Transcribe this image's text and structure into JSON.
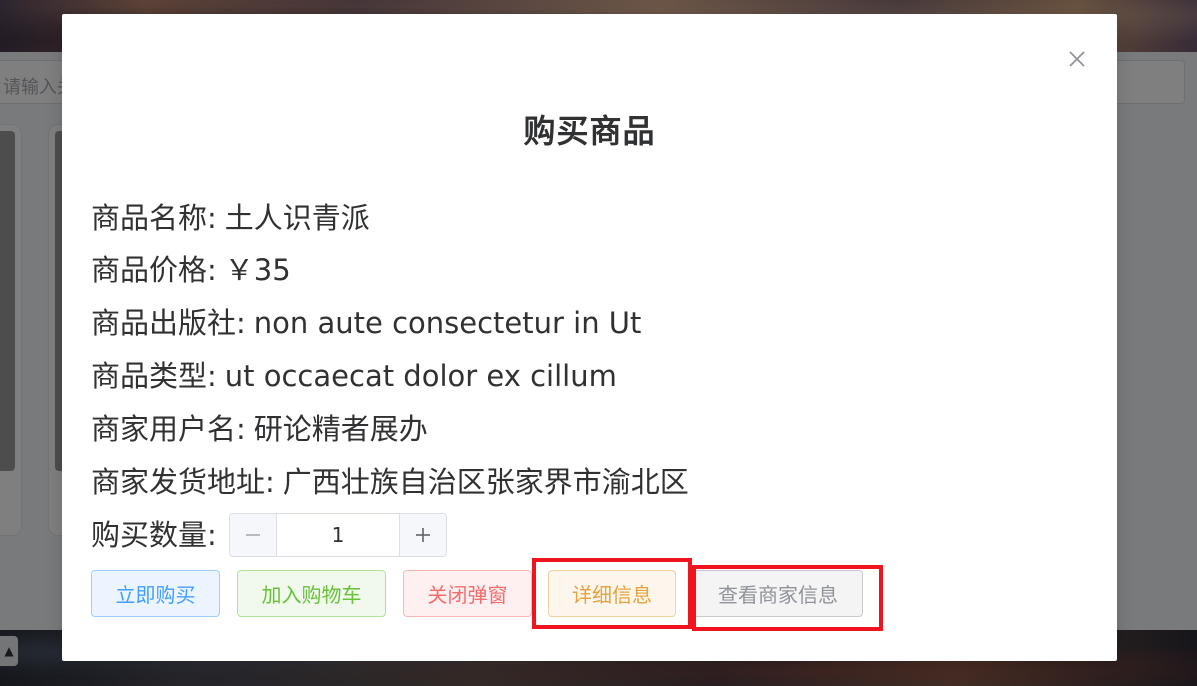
{
  "background": {
    "search_placeholder": "请输入关"
  },
  "dialog": {
    "title": "购买商品",
    "close_icon": "close-icon",
    "fields": [
      {
        "label": "商品名称:",
        "value": "土人识青派"
      },
      {
        "label": "商品价格:",
        "value": "￥35"
      },
      {
        "label": "商品出版社:",
        "value": "non aute consectetur in Ut"
      },
      {
        "label": "商品类型:",
        "value": "ut occaecat dolor ex cillum"
      },
      {
        "label": "商家用户名:",
        "value": "研论精者展办"
      },
      {
        "label": "商家发货地址:",
        "value": "广西壮族自治区张家界市渝北区"
      }
    ],
    "quantity": {
      "label": "购买数量:",
      "value": "1",
      "minus_icon": "minus-icon",
      "plus_icon": "plus-icon"
    },
    "buttons": {
      "buy_now": "立即购买",
      "add_to_cart": "加入购物车",
      "close_dialog": "关闭弹窗",
      "details": "详细信息",
      "view_merchant": "查看商家信息"
    }
  },
  "colors": {
    "primary": "#409eff",
    "success": "#67c23a",
    "danger": "#f56c6c",
    "warning": "#e6a23c",
    "info": "#909399",
    "highlight": "#f0141e"
  }
}
